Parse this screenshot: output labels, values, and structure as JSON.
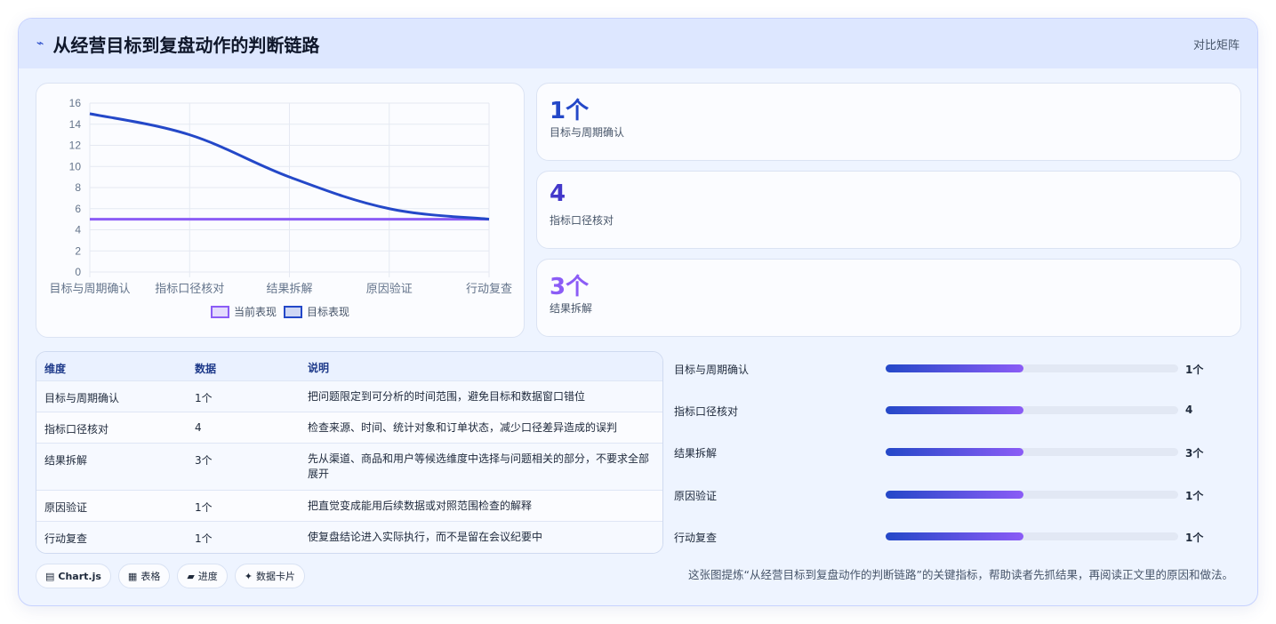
{
  "header": {
    "title": "从经营目标到复盘动作的判断链路",
    "right_label": "对比矩阵",
    "icon": "pulse-icon"
  },
  "chart_data": {
    "type": "line",
    "categories": [
      "目标与周期确认",
      "指标口径核对",
      "结果拆解",
      "原因验证",
      "行动复查"
    ],
    "series": [
      {
        "name": "当前表现",
        "values": [
          5,
          5,
          5,
          5,
          5
        ],
        "color": "#8b5cf6"
      },
      {
        "name": "目标表现",
        "values": [
          15,
          13,
          9,
          6,
          5
        ],
        "color": "#2448c8"
      }
    ],
    "ylim": [
      0,
      16
    ],
    "yticks": [
      0,
      2,
      4,
      6,
      8,
      10,
      12,
      14,
      16
    ],
    "legend": "bottom",
    "grid": true
  },
  "stats": [
    {
      "value": "1个",
      "label": "目标与周期确认",
      "color": "#2448c8"
    },
    {
      "value": "4",
      "label": "指标口径核对",
      "color": "#4338ca"
    },
    {
      "value": "3个",
      "label": "结果拆解",
      "color": "#8b5cf6"
    }
  ],
  "table": {
    "headers": [
      "维度",
      "数据",
      "说明"
    ],
    "rows": [
      [
        "目标与周期确认",
        "1个",
        "把问题限定到可分析的时间范围，避免目标和数据窗口错位"
      ],
      [
        "指标口径核对",
        "4",
        "检查来源、时间、统计对象和订单状态，减少口径差异造成的误判"
      ],
      [
        "结果拆解",
        "3个",
        "先从渠道、商品和用户等候选维度中选择与问题相关的部分，不要求全部展开"
      ],
      [
        "原因验证",
        "1个",
        "把直觉变成能用后续数据或对照范围检查的解释"
      ],
      [
        "行动复查",
        "1个",
        "使复盘结论进入实际执行，而不是留在会议纪要中"
      ]
    ]
  },
  "progress": [
    {
      "label": "目标与周期确认",
      "value": "1个",
      "fraction": 0.47
    },
    {
      "label": "指标口径核对",
      "value": "4",
      "fraction": 0.47
    },
    {
      "label": "结果拆解",
      "value": "3个",
      "fraction": 0.47
    },
    {
      "label": "原因验证",
      "value": "1个",
      "fraction": 0.47
    },
    {
      "label": "行动复查",
      "value": "1个",
      "fraction": 0.47
    }
  ],
  "tags": [
    {
      "icon": "▤",
      "label": "Chart.js"
    },
    {
      "icon": "▦",
      "label": "表格"
    },
    {
      "icon": "▰",
      "label": "进度"
    },
    {
      "icon": "✦",
      "label": "数据卡片"
    }
  ],
  "caption": "这张图提炼“从经营目标到复盘动作的判断链路”的关键指标，帮助读者先抓结果，再阅读正文里的原因和做法。"
}
